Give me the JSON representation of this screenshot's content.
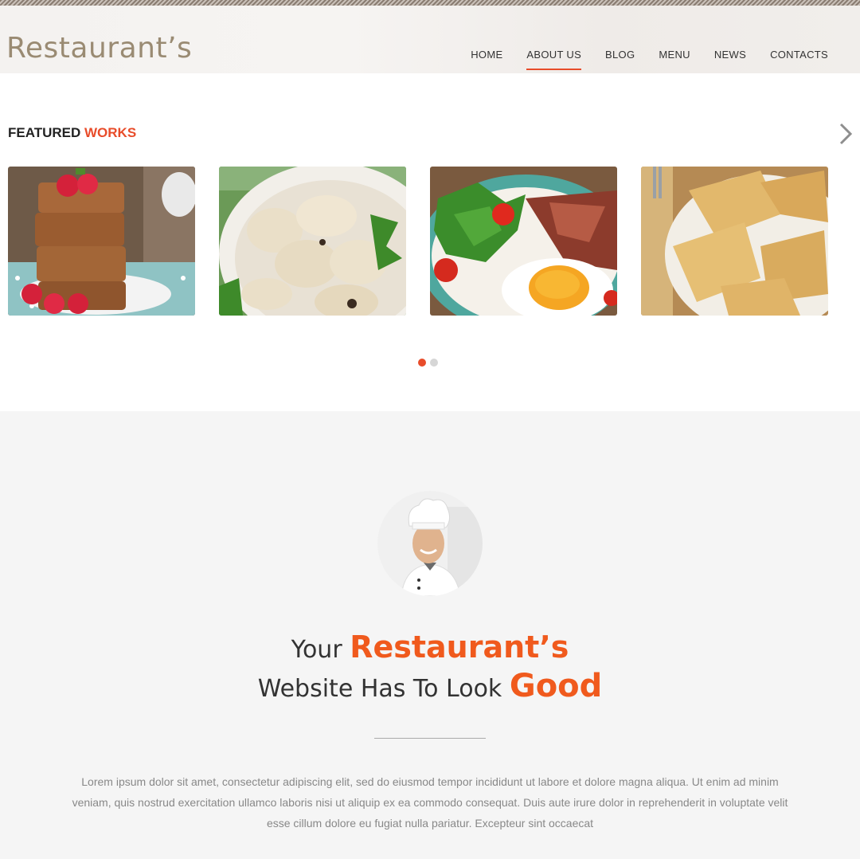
{
  "header": {
    "logo": "Restaurant’s",
    "nav": [
      "HOME",
      "ABOUT US",
      "BLOG",
      "MENU",
      "NEWS",
      "CONTACTS"
    ],
    "active_nav": "ABOUT US"
  },
  "featured": {
    "title_part1": "FEATURED ",
    "title_part2": "WORKS",
    "items": [
      "raspberry-oat-bars",
      "dumplings",
      "fried-egg-with-steak",
      "crepes"
    ]
  },
  "carousel": {
    "page": 1,
    "total": 2
  },
  "about": {
    "line1_prefix": "Your ",
    "line1_emphasis": "Restaurant’s",
    "line2_prefix": "Website Has To Look ",
    "line2_emphasis": "Good",
    "paragraph": "Lorem ipsum dolor sit amet, consectetur adipiscing elit, sed do eiusmod tempor incididunt ut labore et dolore magna aliqua. Ut enim ad minim veniam, quis nostrud exercitation ullamco laboris nisi ut aliquip ex ea commodo consequat. Duis aute irure dolor in reprehenderit in voluptate velit esse cillum dolore eu fugiat nulla pariatur. Excepteur sint occaecat"
  },
  "colors": {
    "accent": "#e84c2a",
    "logo": "#9a8b73",
    "dot_inactive": "#d6d6d6",
    "section_bg": "#f5f5f5"
  }
}
